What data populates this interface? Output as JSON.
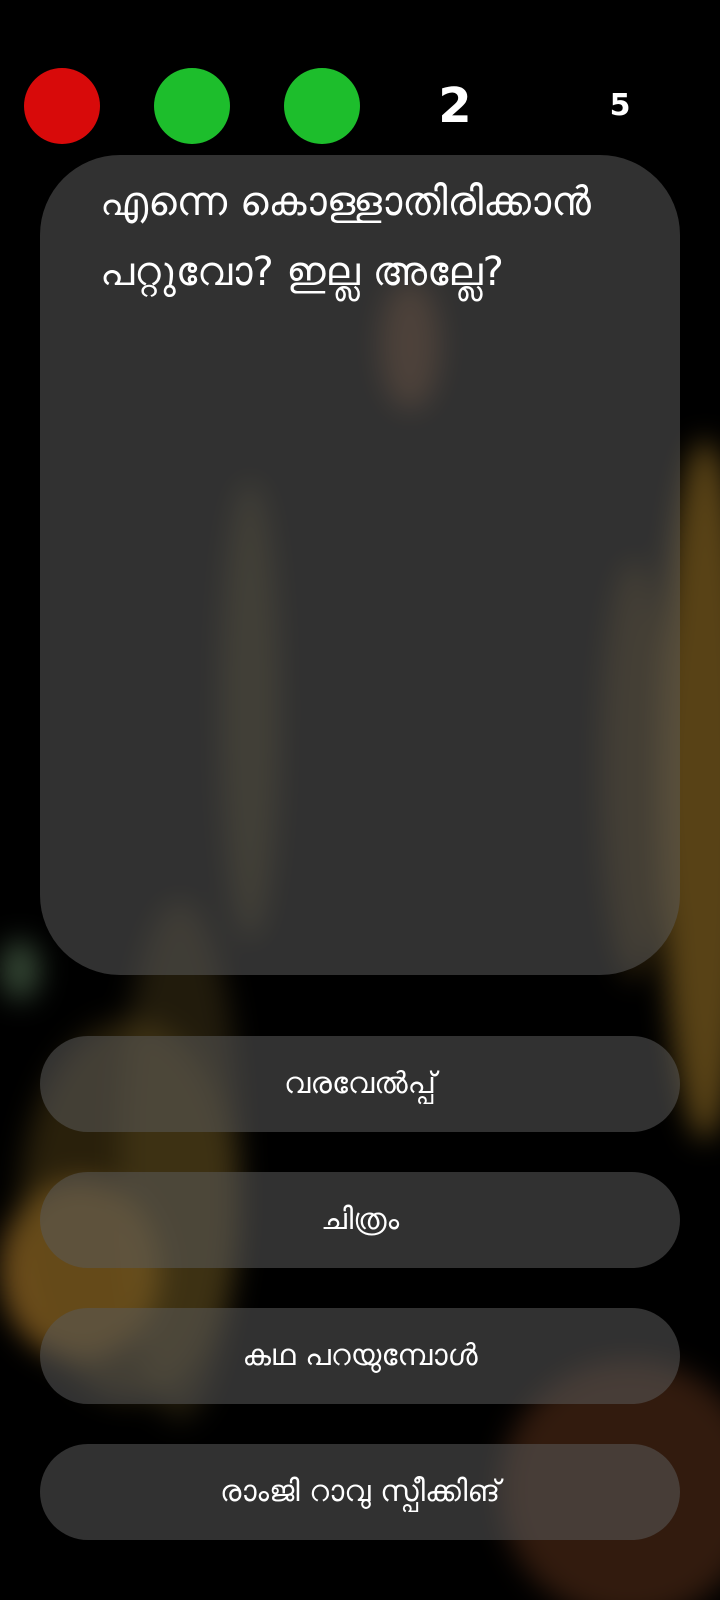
{
  "status": {
    "lives": [
      {
        "state": "lost",
        "color": "#D80A0A"
      },
      {
        "state": "remaining",
        "color": "#1DBE2C"
      },
      {
        "state": "remaining",
        "color": "#1DBE2C"
      }
    ],
    "level": "2",
    "timer": "5"
  },
  "question": {
    "text": "എന്നെ കൊള്ളാതിരിക്കാൻ പറ്റുവോ? ഇല്ല അല്ലേ?"
  },
  "options": [
    {
      "label": "വരവേൽപ്പ്"
    },
    {
      "label": "ചിത്രം"
    },
    {
      "label": "കഥ പറയുമ്പോൾ"
    },
    {
      "label": "രാംജി റാവു സ്പീക്കിങ്"
    }
  ],
  "colors": {
    "background": "#000000",
    "card": "#5A5A5A",
    "text": "#FFFFFF"
  }
}
